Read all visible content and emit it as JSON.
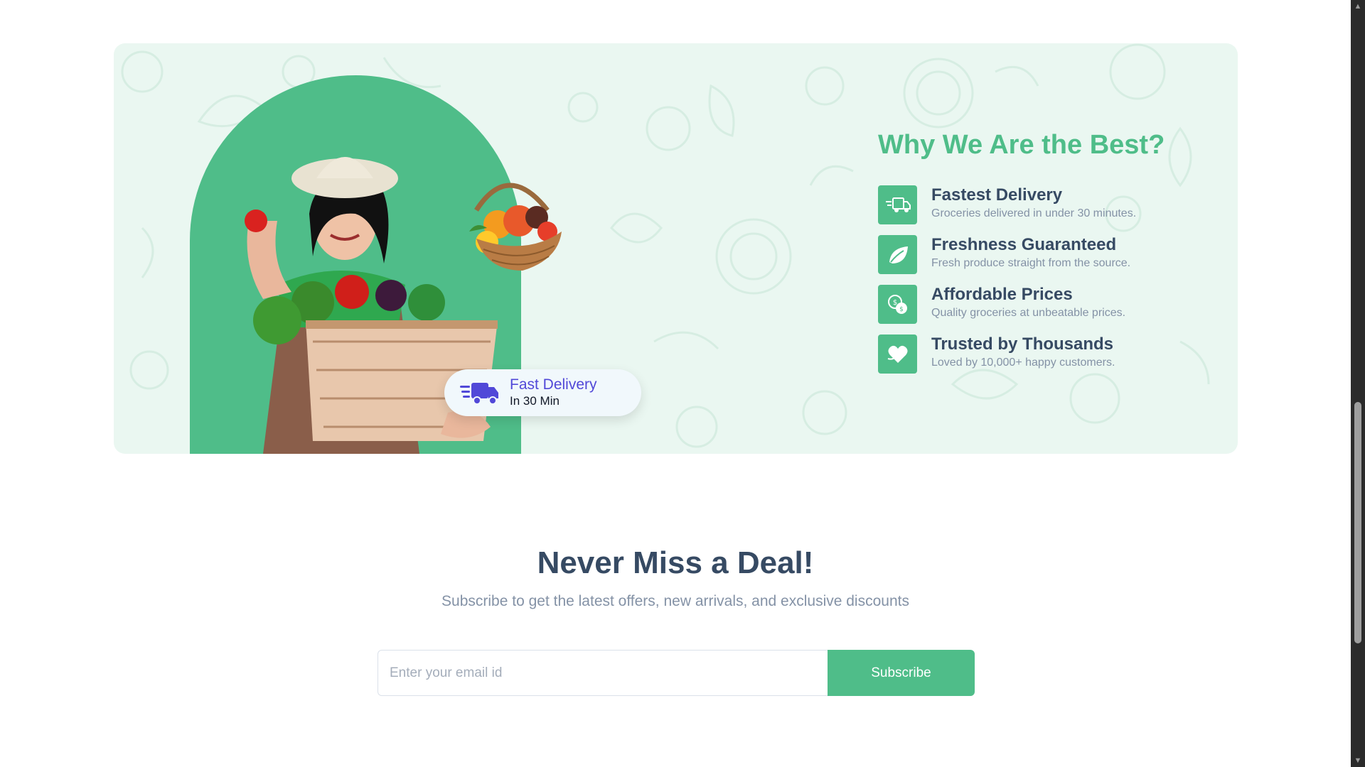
{
  "why": {
    "title": "Why We Are the Best?",
    "badge": {
      "line1": "Fast Delivery",
      "line2": "In 30 Min"
    },
    "features": [
      {
        "icon": "truck-icon",
        "title": "Fastest Delivery",
        "desc": "Groceries delivered in under 30 minutes."
      },
      {
        "icon": "leaf-icon",
        "title": "Freshness Guaranteed",
        "desc": "Fresh produce straight from the source."
      },
      {
        "icon": "coins-icon",
        "title": "Affordable Prices",
        "desc": "Quality groceries at unbeatable prices."
      },
      {
        "icon": "heart-icon",
        "title": "Trusted by Thousands",
        "desc": "Loved by 10,000+ happy customers."
      }
    ]
  },
  "newsletter": {
    "title": "Never Miss a Deal!",
    "subtitle": "Subscribe to get the latest offers, new arrivals, and exclusive discounts",
    "placeholder": "Enter your email id",
    "button": "Subscribe"
  },
  "colors": {
    "accent": "#4fbd89",
    "badge_text": "#5148d8",
    "heading": "#364a63",
    "muted": "#8492a6",
    "card_bg": "#eaf7f1"
  }
}
